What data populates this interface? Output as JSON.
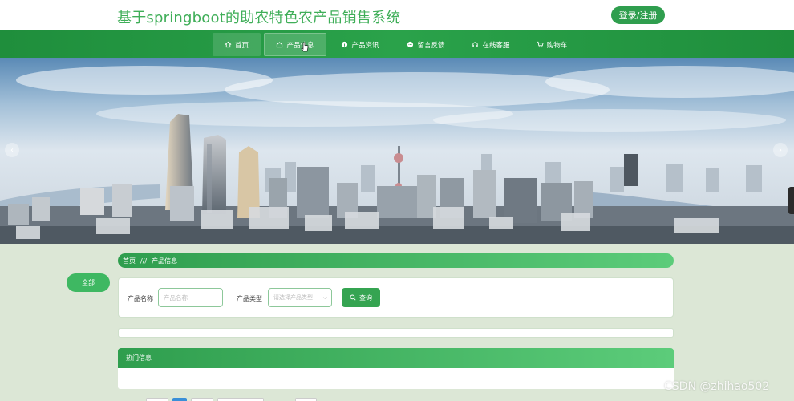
{
  "header": {
    "site_title": "基于springboot的助农特色农产品销售系统",
    "login_label": "登录/注册"
  },
  "nav": {
    "items": [
      {
        "label": "首页",
        "icon": "home-icon"
      },
      {
        "label": "产品信息",
        "icon": "house-icon"
      },
      {
        "label": "产品资讯",
        "icon": "info-icon"
      },
      {
        "label": "留言反馈",
        "icon": "message-icon"
      },
      {
        "label": "在线客服",
        "icon": "headset-icon"
      },
      {
        "label": "购物车",
        "icon": "cart-icon"
      }
    ]
  },
  "breadcrumb": {
    "home": "首页",
    "separator": "///",
    "current": "产品信息"
  },
  "filter": {
    "all_label": "全部"
  },
  "search": {
    "name_label": "产品名称",
    "name_placeholder": "产品名称",
    "type_label": "产品类型",
    "type_placeholder": "请选择产品类型",
    "query_label": "查询"
  },
  "hot": {
    "title": "热门信息"
  },
  "watermark": "CSDN @zhihao502",
  "colors": {
    "brand_green": "#2f9e4e",
    "title_green": "#3fae58",
    "page_bg": "#dce7d6"
  }
}
